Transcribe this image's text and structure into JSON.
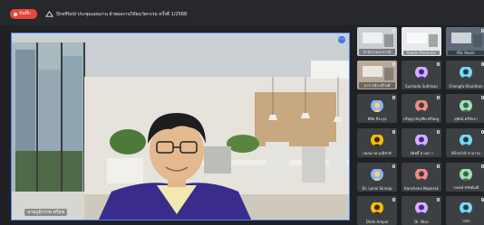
{
  "topbar": {
    "rec_label": "บันทึก",
    "meeting_title": "Sheffield ประชุมแผนงาน ฝ่ายผลงานวิจัยนวัตกรรม ครั้งที่ 1/2568"
  },
  "main_speaker": {
    "name": "นายภูมิวรรษ ศรีสุข"
  },
  "participants": [
    {
      "label": "สำนักงานอาจารย์",
      "type": "video"
    },
    {
      "label": "Teams Presenter",
      "type": "video"
    },
    {
      "label": "Mic Room",
      "type": "video"
    },
    {
      "label": "อาจารย์จ ศรีวงศ์",
      "type": "video"
    },
    {
      "label": "Suchada Suthisan",
      "type": "avatar"
    },
    {
      "label": "Chengfa Khunthon",
      "type": "avatar"
    },
    {
      "label": "พิชิต ธีระกุล",
      "type": "avatar"
    },
    {
      "label": "ปริญญาบัญฑิต ศรีสมบูรณ์",
      "type": "avatar"
    },
    {
      "label": "สุทัศน์ ศรีสัจจา",
      "type": "avatar"
    },
    {
      "label": "เสมอภาค มณีชาติ",
      "type": "avatar"
    },
    {
      "label": "สมิทธิ์ ดวงดาว",
      "type": "avatar"
    },
    {
      "label": "Wirachit สามารถ",
      "type": "avatar"
    },
    {
      "label": "Dr. Lanai Sirinop",
      "type": "avatar"
    },
    {
      "label": "Kanchana Noparak",
      "type": "avatar"
    },
    {
      "label": "วรพงษ์ ทรัพย์มณี",
      "type": "avatar"
    },
    {
      "label": "Direk Ampol",
      "type": "avatar"
    },
    {
      "label": "Dr. Nisa",
      "type": "avatar"
    },
    {
      "label": "วรดร",
      "type": "avatar"
    }
  ]
}
